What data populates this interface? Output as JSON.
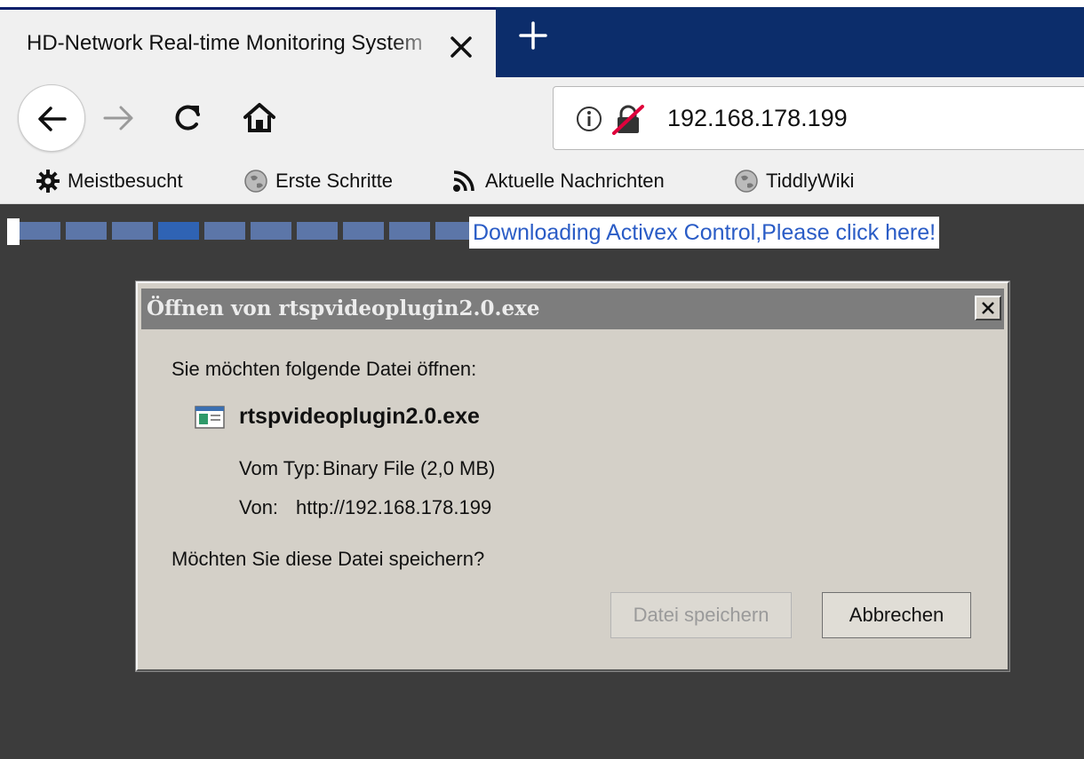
{
  "tab": {
    "title": "HD-Network Real-time Monitoring System",
    "close_icon": "close-icon",
    "new_tab_icon": "plus-icon"
  },
  "navbar": {
    "back_icon": "arrow-left-icon",
    "forward_icon": "arrow-right-icon",
    "reload_icon": "reload-icon",
    "home_icon": "home-icon",
    "url": "192.168.178.199",
    "info_icon": "info-icon",
    "insecure_icon": "insecure-lock-icon"
  },
  "bookmarks": [
    {
      "label": "Meistbesucht",
      "icon": "gear-icon"
    },
    {
      "label": "Erste Schritte",
      "icon": "globe-icon"
    },
    {
      "label": "Aktuelle Nachrichten",
      "icon": "rss-icon"
    },
    {
      "label": "TiddlyWiki",
      "icon": "globe-icon"
    }
  ],
  "page": {
    "download_link": "Downloading Activex Control,Please click here!",
    "loader_segments": 10,
    "loader_active_index": 3
  },
  "dialog": {
    "title": "Öffnen von rtspvideoplugin2.0.exe",
    "intro": "Sie möchten folgende Datei öffnen:",
    "file_name": "rtspvideoplugin2.0.exe",
    "type_label": "Vom Typ:",
    "type_value": "Binary File (2,0 MB)",
    "from_label": "Von:",
    "from_value": "http://192.168.178.199",
    "question": "Möchten Sie diese Datei speichern?",
    "save_button": "Datei speichern",
    "cancel_button": "Abbrechen",
    "close_button": "×"
  },
  "colors": {
    "tabstrip": "#0c2d6b",
    "link": "#2a5cc6",
    "loader_segment": "#5c76a8",
    "loader_active": "#2f63b4",
    "dialog_bg": "#d4d0c8",
    "dialog_titlebar": "#7d7d7d"
  }
}
